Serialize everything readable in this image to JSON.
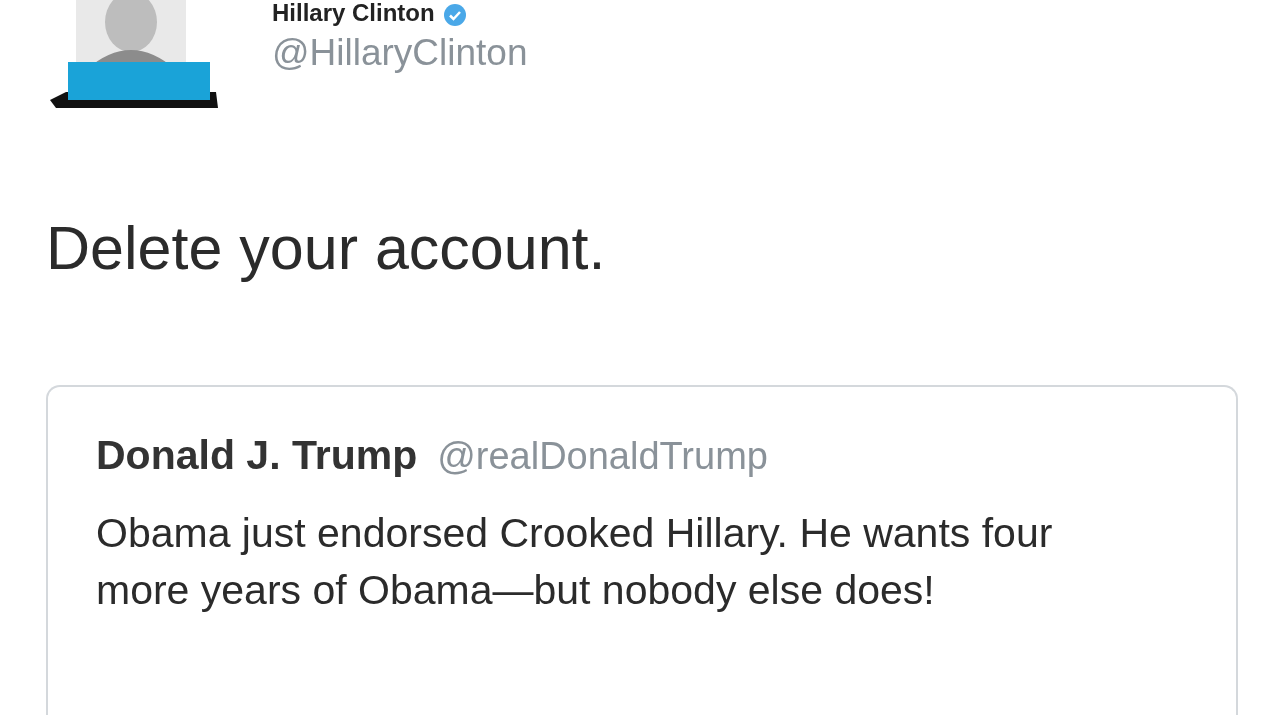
{
  "author": {
    "name": "Hillary Clinton",
    "verified": true,
    "handle": "@HillaryClinton"
  },
  "text": "Delete your account.",
  "quoted_tweet": {
    "name": "Donald J. Trump",
    "handle": "@realDonaldTrump",
    "text": "Obama just endorsed Crooked Hillary. He wants four more years of Obama—but nobody else does!"
  }
}
